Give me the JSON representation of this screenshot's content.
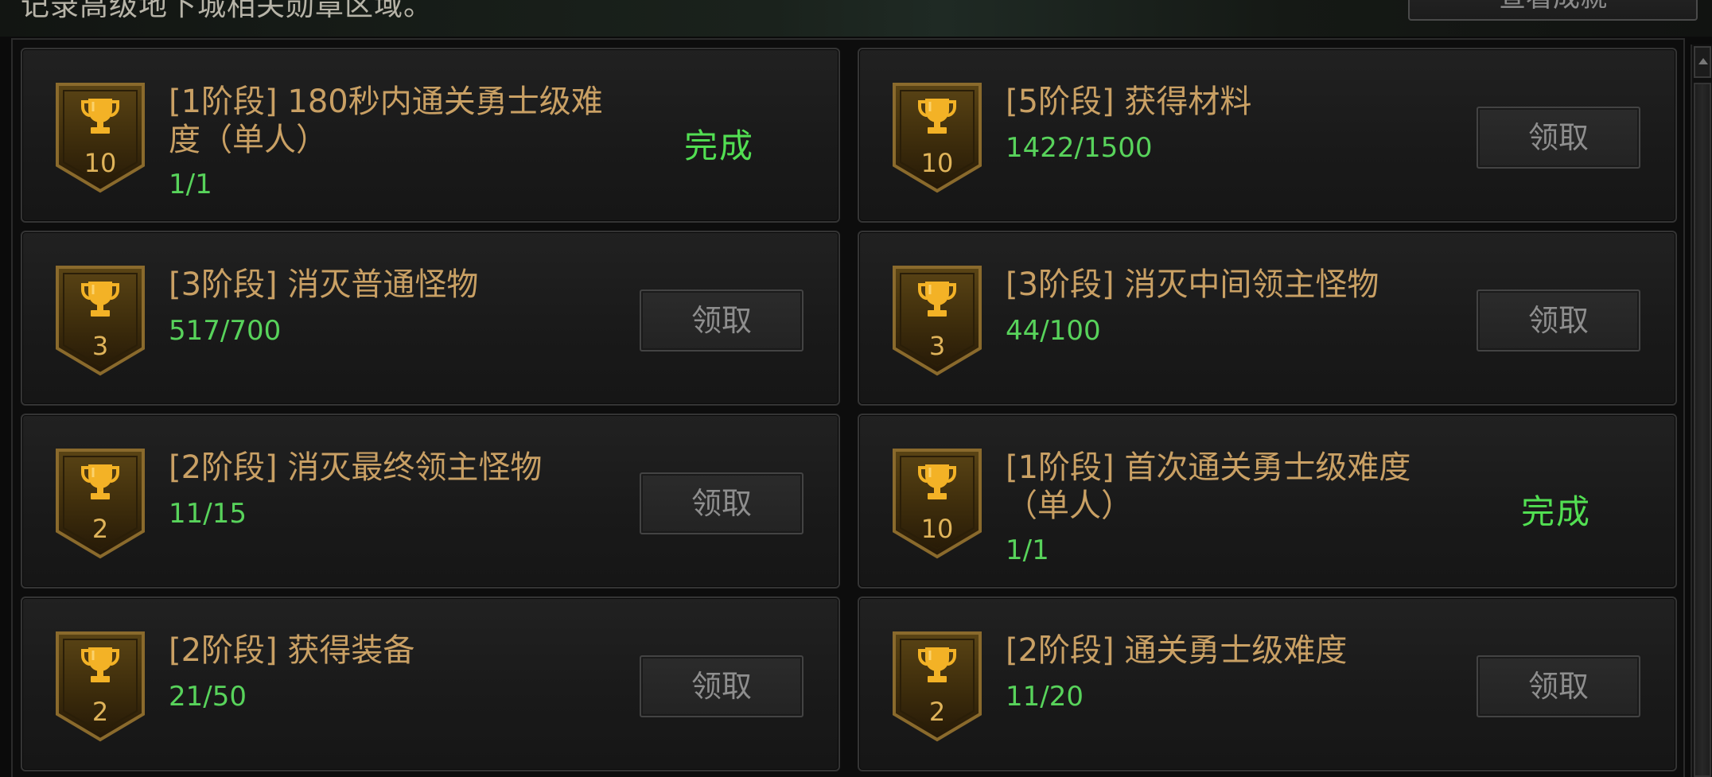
{
  "header": {
    "text": "记录高级地下城相关勋章区域。",
    "button_label": "查看成就"
  },
  "colors": {
    "title": "#c9a064",
    "progress": "#58d35b",
    "done": "#52df52",
    "badge_number": "#e0b45a"
  },
  "icons": {
    "badge": "trophy-icon",
    "scroll": "chevron-up-icon"
  },
  "achievements": [
    {
      "points": "10",
      "title": "[1阶段] 180秒内通关勇士级难度（单人）",
      "progress": "1/1",
      "status": "done",
      "status_label": "完成"
    },
    {
      "points": "10",
      "title": "[5阶段] 获得材料",
      "progress": "1422/1500",
      "status": "claim",
      "status_label": "领取"
    },
    {
      "points": "3",
      "title": "[3阶段] 消灭普通怪物",
      "progress": "517/700",
      "status": "claim",
      "status_label": "领取"
    },
    {
      "points": "3",
      "title": "[3阶段] 消灭中间领主怪物",
      "progress": "44/100",
      "status": "claim",
      "status_label": "领取"
    },
    {
      "points": "2",
      "title": "[2阶段] 消灭最终领主怪物",
      "progress": "11/15",
      "status": "claim",
      "status_label": "领取"
    },
    {
      "points": "10",
      "title": "[1阶段] 首次通关勇士级难度（单人）",
      "progress": "1/1",
      "status": "done",
      "status_label": "完成"
    },
    {
      "points": "2",
      "title": "[2阶段] 获得装备",
      "progress": "21/50",
      "status": "claim",
      "status_label": "领取"
    },
    {
      "points": "2",
      "title": "[2阶段] 通关勇士级难度",
      "progress": "11/20",
      "status": "claim",
      "status_label": "领取"
    }
  ]
}
